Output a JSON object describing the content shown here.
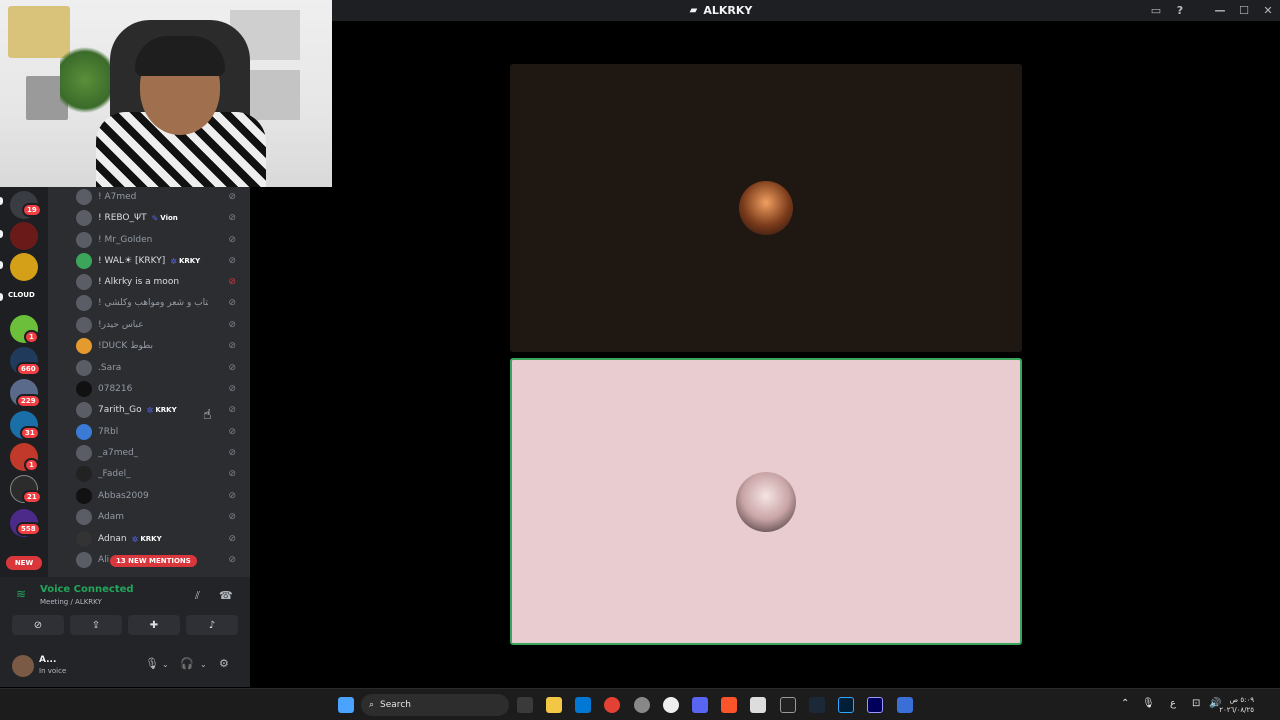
{
  "window": {
    "title": "ALKRKY",
    "controls": [
      "inbox-icon",
      "help-icon",
      "minimize-icon",
      "maximize-icon",
      "close-icon"
    ]
  },
  "stage": {
    "tiles": [
      {
        "avatar": "avatar-icon",
        "speaking": false,
        "bg": "#1f1812"
      },
      {
        "avatar": "avatar-icon",
        "speaking": true,
        "bg": "#e8cccf"
      }
    ]
  },
  "servers": {
    "badges": [
      "19",
      "1",
      "660",
      "229",
      "31",
      "1",
      "21",
      "558"
    ],
    "labels": [
      "CLOUD",
      "NEW"
    ]
  },
  "members": [
    {
      "name": "! A7med",
      "tag": ""
    },
    {
      "name": "! REBO_ΨT",
      "tag": "Vion"
    },
    {
      "name": "! Mr_Golden",
      "tag": ""
    },
    {
      "name": "! WAL☀ [KRKY]",
      "tag": "KRKY"
    },
    {
      "name": "! Alkrky is a moon",
      "tag": ""
    },
    {
      "name": "! عدي عتاب و شعر ومواهب وكلشي",
      "tag": ""
    },
    {
      "name": "!عباس حيدر",
      "tag": ""
    },
    {
      "name": "!DUCK بطوط",
      "tag": ""
    },
    {
      "name": ".Sara",
      "tag": ""
    },
    {
      "name": "078216",
      "tag": ""
    },
    {
      "name": "7arith_Go",
      "tag": "KRKY"
    },
    {
      "name": "7Rbl",
      "tag": ""
    },
    {
      "name": "_a7med_",
      "tag": ""
    },
    {
      "name": "_Fadel_",
      "tag": ""
    },
    {
      "name": "Abbas2009",
      "tag": ""
    },
    {
      "name": "Adam",
      "tag": ""
    },
    {
      "name": "Adnan",
      "tag": "KRKY"
    },
    {
      "name": "Ali",
      "tag": ""
    }
  ],
  "mentions_pill": "13 NEW MENTIONS",
  "voice": {
    "status": "Voice Connected",
    "channel": "Meeting / ALKRKY"
  },
  "user": {
    "name": "A...",
    "status": "In voice"
  },
  "taskbar": {
    "search_label": "Search",
    "clock_time": "٥:٠٩ ص",
    "clock_date": "٢٠٢٦/٠٨/٢٥",
    "lang": "ع"
  },
  "colors": {
    "accent_green": "#23a55a",
    "danger": "#da373c",
    "brand": "#5865f2"
  }
}
